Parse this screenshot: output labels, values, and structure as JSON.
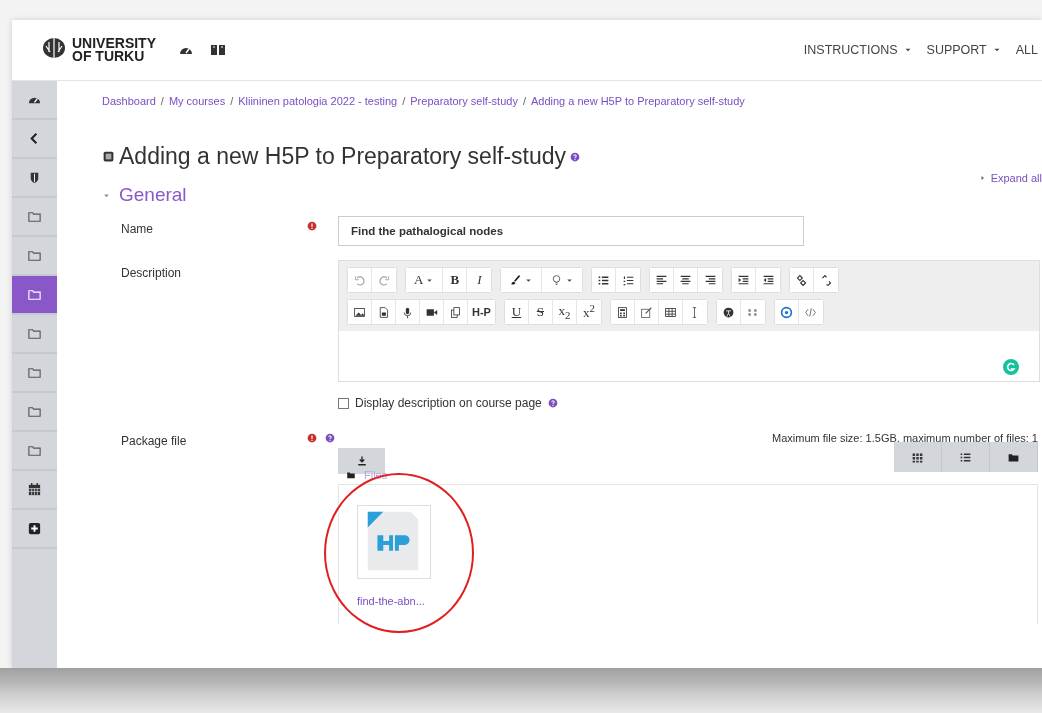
{
  "header": {
    "logo_lines": [
      "UNIVERSITY",
      "OF TURKU"
    ],
    "icons": [
      {
        "kind": "gauge"
      },
      {
        "kind": "book"
      }
    ],
    "menu": [
      {
        "label": "INSTRUCTIONS",
        "dropdown": true
      },
      {
        "label": "SUPPORT",
        "dropdown": true
      },
      {
        "label": "ALL",
        "dropdown": false
      }
    ]
  },
  "sidebar": {
    "items": [
      {
        "kind": "gauge",
        "selected": false
      },
      {
        "kind": "collapse",
        "selected": false
      },
      {
        "kind": "shield",
        "selected": false
      },
      {
        "kind": "folder",
        "selected": false
      },
      {
        "kind": "folder",
        "selected": false
      },
      {
        "kind": "folder",
        "selected": true
      },
      {
        "kind": "folder",
        "selected": false
      },
      {
        "kind": "folder",
        "selected": false
      },
      {
        "kind": "folder",
        "selected": false
      },
      {
        "kind": "folder",
        "selected": false
      },
      {
        "kind": "calendar",
        "selected": false
      },
      {
        "kind": "add",
        "selected": false
      }
    ]
  },
  "breadcrumb": [
    {
      "label": "Dashboard"
    },
    {
      "separator": "/",
      "label": "My courses"
    },
    {
      "separator": "/",
      "label": "Kliininen patologia 2022 - testing"
    },
    {
      "separator": "/",
      "label": "Preparatory self-study"
    },
    {
      "separator": "/",
      "label": "Adding a new H5P to Preparatory self-study"
    }
  ],
  "page_title": "Adding a new H5P to Preparatory self-study",
  "expand_all": "Expand all",
  "section": {
    "title": "General",
    "expanded": true
  },
  "fields": [
    {
      "kind": "text",
      "label": "Name",
      "required": true,
      "help": false,
      "value": "Find the pathalogical nodes"
    },
    {
      "kind": "editor",
      "label": "Description",
      "required": false,
      "help": false
    },
    {
      "kind": "file",
      "label": "Package file",
      "required": true,
      "help": true
    }
  ],
  "editor": {
    "toolbar_rows": [
      [
        [
          {
            "kind": "undo"
          },
          {
            "kind": "redo"
          }
        ],
        [
          {
            "kind": "plain",
            "label": "A",
            "dropdown": true
          },
          {
            "kind": "bold",
            "label": "B"
          },
          {
            "kind": "italic",
            "label": "I"
          }
        ],
        [
          {
            "kind": "brush",
            "dropdown": true
          },
          {
            "kind": "bulb",
            "dropdown": true
          }
        ],
        [
          {
            "kind": "ul"
          },
          {
            "kind": "ol"
          }
        ],
        [
          {
            "kind": "align-left"
          },
          {
            "kind": "align-center"
          },
          {
            "kind": "align-right"
          }
        ],
        [
          {
            "kind": "outdent"
          },
          {
            "kind": "indent"
          }
        ],
        [
          {
            "kind": "link"
          },
          {
            "kind": "unlink"
          }
        ]
      ],
      [
        [
          {
            "kind": "image"
          },
          {
            "kind": "media"
          },
          {
            "kind": "mic"
          },
          {
            "kind": "video"
          },
          {
            "kind": "copy"
          },
          {
            "kind": "logo",
            "label": "H-P"
          }
        ],
        [
          {
            "kind": "underline",
            "label": "U"
          },
          {
            "kind": "strike",
            "label": "S"
          },
          {
            "kind": "plain",
            "label": "x$_{2}$"
          },
          {
            "kind": "plain",
            "label": "x$^{2}$"
          }
        ],
        [
          {
            "kind": "calc"
          },
          {
            "kind": "edit"
          },
          {
            "kind": "table"
          },
          {
            "kind": "cursor"
          }
        ],
        [
          {
            "kind": "accessibility"
          },
          {
            "kind": "screenreader"
          }
        ],
        [
          {
            "kind": "target"
          },
          {
            "kind": "code"
          }
        ]
      ]
    ]
  },
  "display_description": {
    "label": "Display description on course page",
    "checked": false
  },
  "file_picker": {
    "limits": "Maximum file size: 1.5GB, maximum number of files: 1",
    "views": [
      {
        "kind": "grid"
      },
      {
        "kind": "list"
      },
      {
        "kind": "folder"
      }
    ],
    "path": "Files",
    "files": [
      {
        "name": "find-the-abn...",
        "highlighted": true
      }
    ]
  }
}
